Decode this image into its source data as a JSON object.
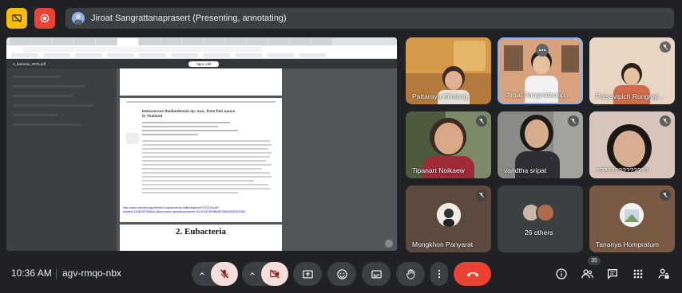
{
  "presenter": {
    "label": "Jiroat Sangrattanaprasert (Presenting, annotating)"
  },
  "shared_screen": {
    "pdf_filename": "4_bacteria_2076.pdf",
    "zoom": "Ngoc edit",
    "page_title_line1": "Halococcus thailandensis sp. nov., from fish sauce",
    "page_title_line2": "in Thailand",
    "page_url": "http://www.microbiologyresearch.org/docserver/fulltext/ijsem/57/9/2136.pdf?expires=1538259760&id=id&accname=guest&checksum=3A47A331FDB94E23B6D80E3A3D83",
    "section_heading": "2. Eubacteria"
  },
  "participants": [
    {
      "name": "Pattaraya Klintong",
      "muted": false
    },
    {
      "name": "Jiroat Sangrattanap...",
      "muted": false
    },
    {
      "name": "Patsavipich Rungrojt...",
      "muted": true
    },
    {
      "name": "Tipanart Noikaew",
      "muted": true
    },
    {
      "name": "varidtha sripat",
      "muted": true
    },
    {
      "name": "??????????????",
      "muted": true
    },
    {
      "name": "Mongkhon Panyarat",
      "muted": true
    },
    {
      "name": "26 others",
      "muted": false
    },
    {
      "name": "Tananya Hompratum",
      "muted": true
    }
  ],
  "bottom_bar": {
    "time": "10:36 AM",
    "meeting_code": "agv-rmqo-nbx",
    "participant_count": "35"
  },
  "colors": {
    "background": "#202124",
    "accent_blue": "#8ab4f8",
    "end_call_red": "#ea4335",
    "muted_pink": "#f9dedc",
    "presenting_yellow": "#fbbc04"
  }
}
